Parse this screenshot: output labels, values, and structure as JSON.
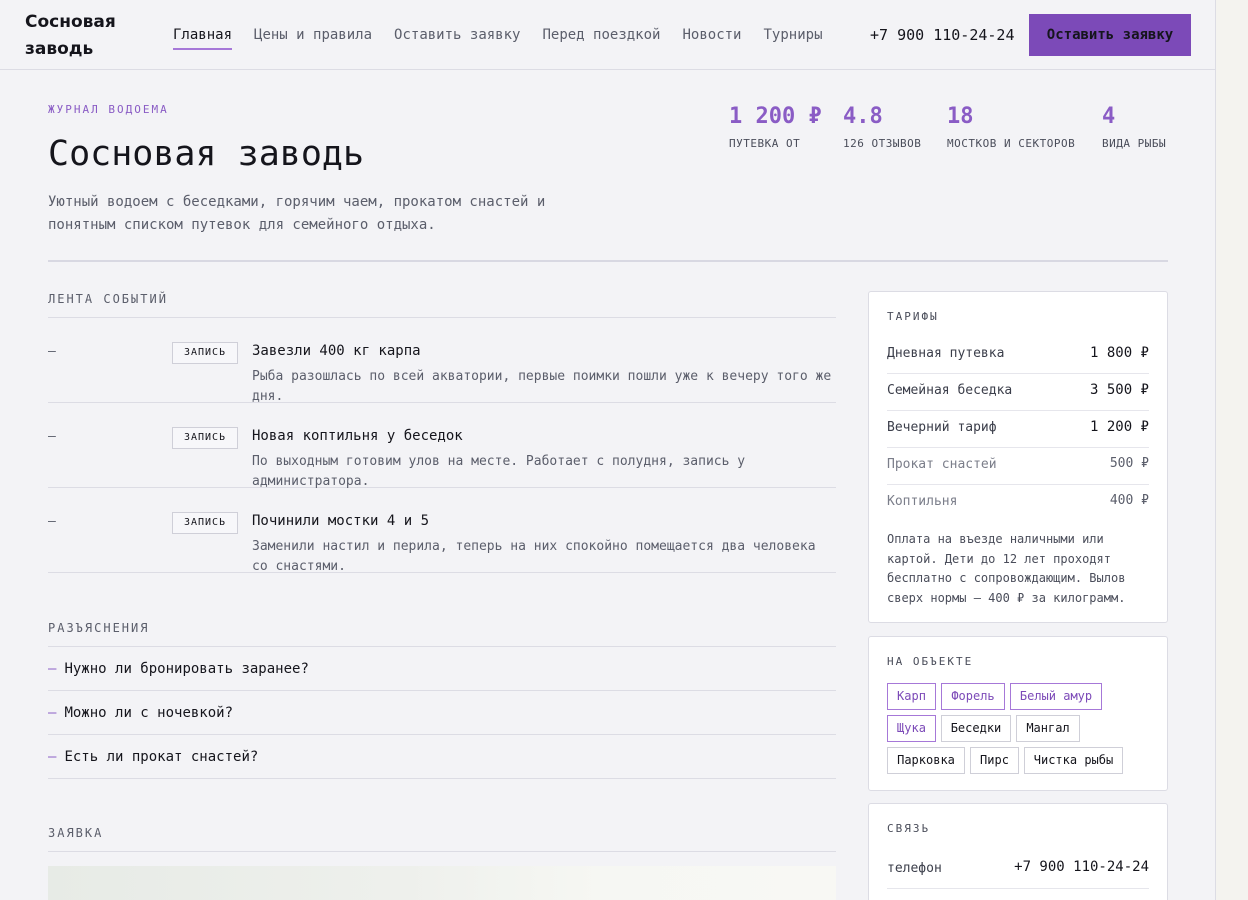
{
  "header": {
    "brand": "Сосновая заводь",
    "nav": [
      {
        "label": "Главная",
        "active": true
      },
      {
        "label": "Цены и правила",
        "active": false
      },
      {
        "label": "Оставить заявку",
        "active": false
      },
      {
        "label": "Перед поездкой",
        "active": false
      },
      {
        "label": "Новости",
        "active": false
      },
      {
        "label": "Турниры",
        "active": false
      }
    ],
    "phone": "+7 900 110-24-24",
    "cta_label": "Оставить заявку"
  },
  "hero": {
    "eyebrow": "ЖУРНАЛ ВОДОЕМА",
    "title": "Сосновая заводь",
    "subtitle": "Уютный водоем с беседками, горячим чаем, прокатом снастей и понятным списком путевок для семейного отдыха.",
    "stats": [
      {
        "value": "1 200 ₽",
        "label": "ПУТЕВКА ОТ"
      },
      {
        "value": "4.8",
        "label": "126 ОТЗЫВОВ"
      },
      {
        "value": "18",
        "label": "МОСТКОВ И СЕКТОРОВ"
      },
      {
        "value": "4",
        "label": "ВИДА РЫБЫ"
      }
    ]
  },
  "feed": {
    "heading": "ЛЕНТА СОБЫТИЙ",
    "items": [
      {
        "dash": "—",
        "tag": "ЗАПИСЬ",
        "title": "Завезли 400 кг карпа",
        "text": "Рыба разошлась по всей акватории, первые поимки пошли уже к вечеру того же дня."
      },
      {
        "dash": "—",
        "tag": "ЗАПИСЬ",
        "title": "Новая коптильня у беседок",
        "text": "По выходным готовим улов на месте. Работает с полудня, запись у администратора."
      },
      {
        "dash": "—",
        "tag": "ЗАПИСЬ",
        "title": "Починили мостки 4 и 5",
        "text": "Заменили настил и перила, теперь на них спокойно помещается два человека со снастями."
      }
    ]
  },
  "faq": {
    "heading": "РАЗЪЯСНЕНИЯ",
    "dash": "—",
    "items": [
      {
        "question": "Нужно ли бронировать заранее?"
      },
      {
        "question": "Можно ли с ночевкой?"
      },
      {
        "question": "Есть ли прокат снастей?"
      }
    ]
  },
  "request": {
    "heading": "ЗАЯВКА"
  },
  "tariffs": {
    "heading": "ТАРИФЫ",
    "rows": [
      {
        "name": "Дневная путевка",
        "price": "1 800 ₽"
      },
      {
        "name": "Семейная беседка",
        "price": "3 500 ₽"
      },
      {
        "name": "Вечерний тариф",
        "price": "1 200 ₽"
      },
      {
        "name": "Прокат снастей",
        "price": "500 ₽"
      },
      {
        "name": "Коптильня",
        "price": "400 ₽"
      }
    ],
    "note": "Оплата на въезде наличными или картой. Дети до 12 лет проходят бесплатно с сопровождающим. Вылов сверх нормы — 400 ₽ за килограмм."
  },
  "facilities": {
    "heading": "НА ОБЪЕКТЕ",
    "chips": [
      {
        "label": "Карп",
        "accent": true
      },
      {
        "label": "Форель",
        "accent": true
      },
      {
        "label": "Белый амур",
        "accent": true
      },
      {
        "label": "Щука",
        "accent": true
      },
      {
        "label": "Беседки",
        "accent": false
      },
      {
        "label": "Мангал",
        "accent": false
      },
      {
        "label": "Парковка",
        "accent": false
      },
      {
        "label": "Пирс",
        "accent": false
      },
      {
        "label": "Чистка рыбы",
        "accent": false
      }
    ]
  },
  "contact": {
    "heading": "СВЯЗЬ",
    "phone_label": "телефон",
    "phone_value": "+7 900 110-24-24"
  },
  "colors": {
    "accent": "#7c4ab8",
    "accent_text": "#8a5cc5",
    "background": "#f3f3f6"
  }
}
